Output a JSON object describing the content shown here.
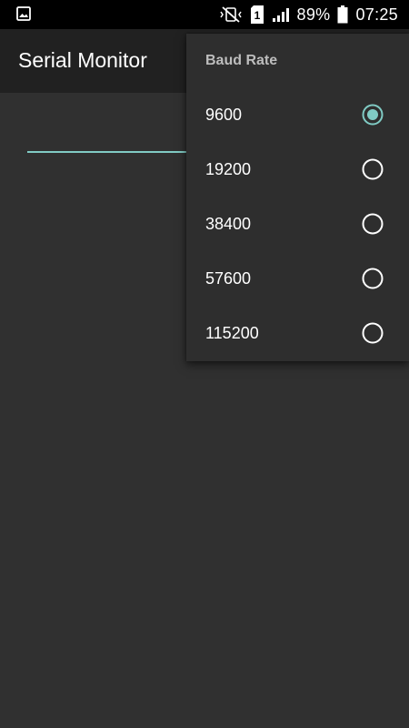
{
  "status_bar": {
    "left_icon": "image-icon",
    "battery_percent": "89%",
    "time": "07:25",
    "sim_badge": "1"
  },
  "app_bar": {
    "title": "Serial Monitor"
  },
  "popup": {
    "title": "Baud Rate",
    "items": [
      {
        "label": "9600",
        "selected": true
      },
      {
        "label": "19200",
        "selected": false
      },
      {
        "label": "38400",
        "selected": false
      },
      {
        "label": "57600",
        "selected": false
      },
      {
        "label": "115200",
        "selected": false
      }
    ]
  },
  "colors": {
    "accent": "#80cbc4",
    "background": "#303030",
    "app_bar": "#212121",
    "popup": "#2e2e2e"
  }
}
